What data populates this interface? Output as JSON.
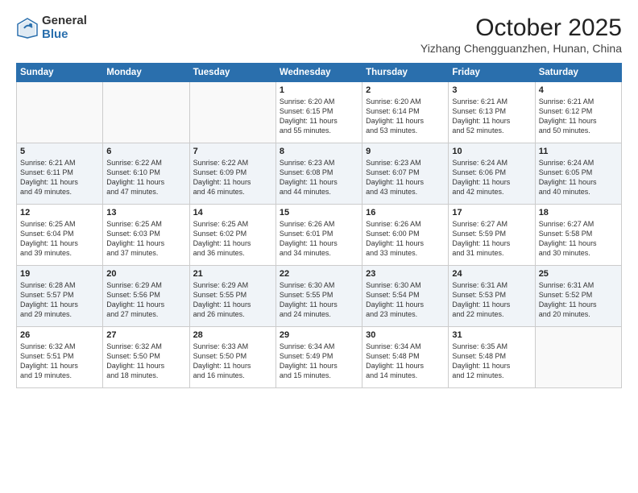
{
  "logo": {
    "general": "General",
    "blue": "Blue"
  },
  "header": {
    "month": "October 2025",
    "location": "Yizhang Chengguanzhen, Hunan, China"
  },
  "days_of_week": [
    "Sunday",
    "Monday",
    "Tuesday",
    "Wednesday",
    "Thursday",
    "Friday",
    "Saturday"
  ],
  "weeks": [
    [
      {
        "day": "",
        "info": ""
      },
      {
        "day": "",
        "info": ""
      },
      {
        "day": "",
        "info": ""
      },
      {
        "day": "1",
        "info": "Sunrise: 6:20 AM\nSunset: 6:15 PM\nDaylight: 11 hours\nand 55 minutes."
      },
      {
        "day": "2",
        "info": "Sunrise: 6:20 AM\nSunset: 6:14 PM\nDaylight: 11 hours\nand 53 minutes."
      },
      {
        "day": "3",
        "info": "Sunrise: 6:21 AM\nSunset: 6:13 PM\nDaylight: 11 hours\nand 52 minutes."
      },
      {
        "day": "4",
        "info": "Sunrise: 6:21 AM\nSunset: 6:12 PM\nDaylight: 11 hours\nand 50 minutes."
      }
    ],
    [
      {
        "day": "5",
        "info": "Sunrise: 6:21 AM\nSunset: 6:11 PM\nDaylight: 11 hours\nand 49 minutes."
      },
      {
        "day": "6",
        "info": "Sunrise: 6:22 AM\nSunset: 6:10 PM\nDaylight: 11 hours\nand 47 minutes."
      },
      {
        "day": "7",
        "info": "Sunrise: 6:22 AM\nSunset: 6:09 PM\nDaylight: 11 hours\nand 46 minutes."
      },
      {
        "day": "8",
        "info": "Sunrise: 6:23 AM\nSunset: 6:08 PM\nDaylight: 11 hours\nand 44 minutes."
      },
      {
        "day": "9",
        "info": "Sunrise: 6:23 AM\nSunset: 6:07 PM\nDaylight: 11 hours\nand 43 minutes."
      },
      {
        "day": "10",
        "info": "Sunrise: 6:24 AM\nSunset: 6:06 PM\nDaylight: 11 hours\nand 42 minutes."
      },
      {
        "day": "11",
        "info": "Sunrise: 6:24 AM\nSunset: 6:05 PM\nDaylight: 11 hours\nand 40 minutes."
      }
    ],
    [
      {
        "day": "12",
        "info": "Sunrise: 6:25 AM\nSunset: 6:04 PM\nDaylight: 11 hours\nand 39 minutes."
      },
      {
        "day": "13",
        "info": "Sunrise: 6:25 AM\nSunset: 6:03 PM\nDaylight: 11 hours\nand 37 minutes."
      },
      {
        "day": "14",
        "info": "Sunrise: 6:25 AM\nSunset: 6:02 PM\nDaylight: 11 hours\nand 36 minutes."
      },
      {
        "day": "15",
        "info": "Sunrise: 6:26 AM\nSunset: 6:01 PM\nDaylight: 11 hours\nand 34 minutes."
      },
      {
        "day": "16",
        "info": "Sunrise: 6:26 AM\nSunset: 6:00 PM\nDaylight: 11 hours\nand 33 minutes."
      },
      {
        "day": "17",
        "info": "Sunrise: 6:27 AM\nSunset: 5:59 PM\nDaylight: 11 hours\nand 31 minutes."
      },
      {
        "day": "18",
        "info": "Sunrise: 6:27 AM\nSunset: 5:58 PM\nDaylight: 11 hours\nand 30 minutes."
      }
    ],
    [
      {
        "day": "19",
        "info": "Sunrise: 6:28 AM\nSunset: 5:57 PM\nDaylight: 11 hours\nand 29 minutes."
      },
      {
        "day": "20",
        "info": "Sunrise: 6:29 AM\nSunset: 5:56 PM\nDaylight: 11 hours\nand 27 minutes."
      },
      {
        "day": "21",
        "info": "Sunrise: 6:29 AM\nSunset: 5:55 PM\nDaylight: 11 hours\nand 26 minutes."
      },
      {
        "day": "22",
        "info": "Sunrise: 6:30 AM\nSunset: 5:55 PM\nDaylight: 11 hours\nand 24 minutes."
      },
      {
        "day": "23",
        "info": "Sunrise: 6:30 AM\nSunset: 5:54 PM\nDaylight: 11 hours\nand 23 minutes."
      },
      {
        "day": "24",
        "info": "Sunrise: 6:31 AM\nSunset: 5:53 PM\nDaylight: 11 hours\nand 22 minutes."
      },
      {
        "day": "25",
        "info": "Sunrise: 6:31 AM\nSunset: 5:52 PM\nDaylight: 11 hours\nand 20 minutes."
      }
    ],
    [
      {
        "day": "26",
        "info": "Sunrise: 6:32 AM\nSunset: 5:51 PM\nDaylight: 11 hours\nand 19 minutes."
      },
      {
        "day": "27",
        "info": "Sunrise: 6:32 AM\nSunset: 5:50 PM\nDaylight: 11 hours\nand 18 minutes."
      },
      {
        "day": "28",
        "info": "Sunrise: 6:33 AM\nSunset: 5:50 PM\nDaylight: 11 hours\nand 16 minutes."
      },
      {
        "day": "29",
        "info": "Sunrise: 6:34 AM\nSunset: 5:49 PM\nDaylight: 11 hours\nand 15 minutes."
      },
      {
        "day": "30",
        "info": "Sunrise: 6:34 AM\nSunset: 5:48 PM\nDaylight: 11 hours\nand 14 minutes."
      },
      {
        "day": "31",
        "info": "Sunrise: 6:35 AM\nSunset: 5:48 PM\nDaylight: 11 hours\nand 12 minutes."
      },
      {
        "day": "",
        "info": ""
      }
    ]
  ]
}
